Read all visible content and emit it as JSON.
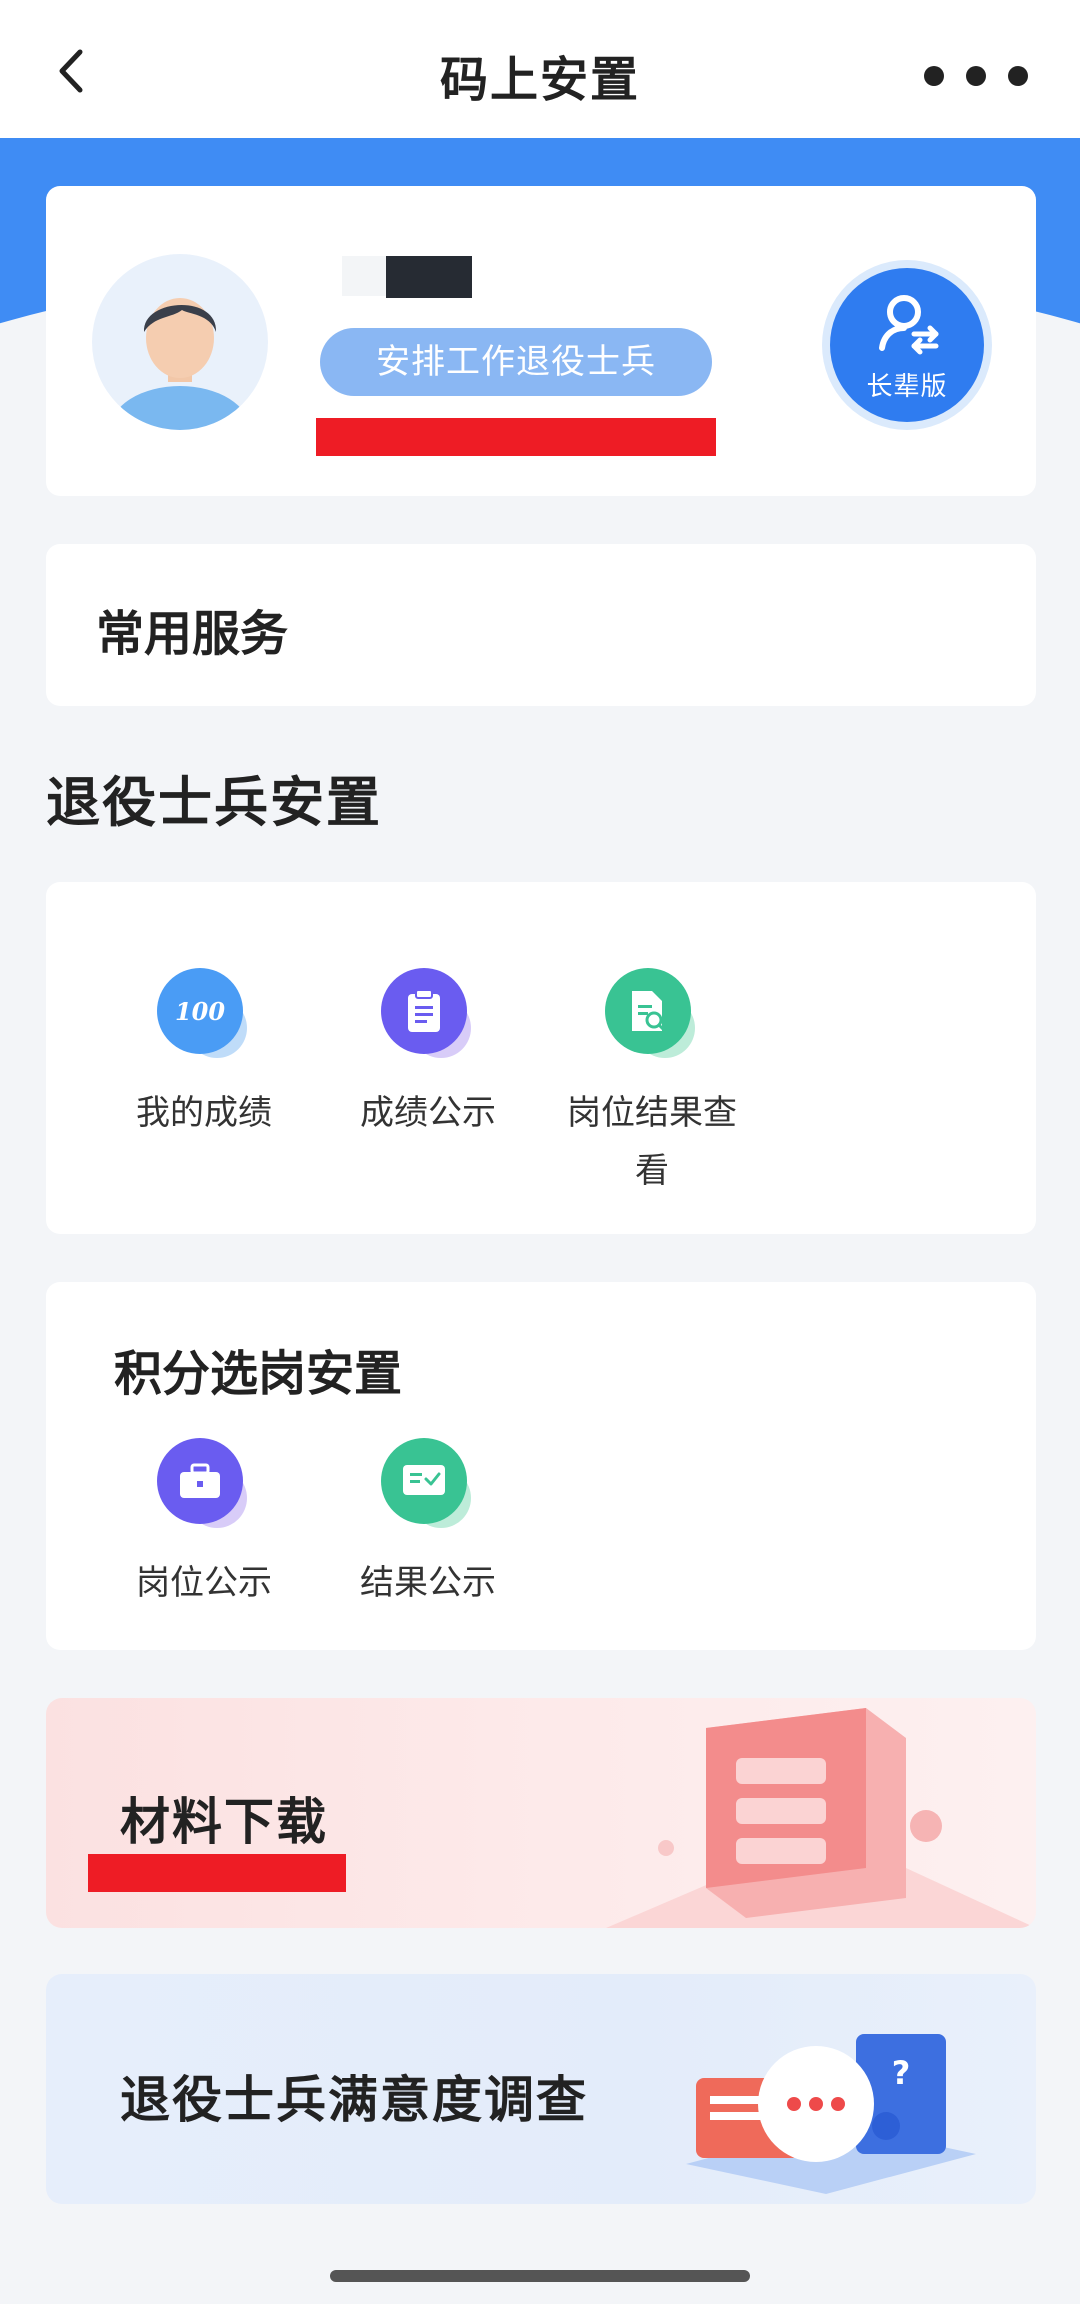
{
  "nav": {
    "title": "码上安置"
  },
  "profile": {
    "tag": "安排工作退役士兵",
    "elder_mode_label": "长辈版"
  },
  "common_services": {
    "label": "常用服务"
  },
  "section": {
    "title": "退役士兵安置"
  },
  "group1": {
    "items": [
      {
        "label": "我的成绩",
        "icon": "score-100-icon",
        "color": "#4a9cf5"
      },
      {
        "label": "成绩公示",
        "icon": "clipboard-icon",
        "color": "#6a5cf0"
      },
      {
        "label": "岗位结果查看",
        "icon": "document-search-icon",
        "color": "#39c393"
      }
    ]
  },
  "group2": {
    "title": "积分选岗安置",
    "items": [
      {
        "label": "岗位公示",
        "icon": "briefcase-icon",
        "color": "#6a5cf0"
      },
      {
        "label": "结果公示",
        "icon": "result-board-icon",
        "color": "#39c393"
      }
    ]
  },
  "material": {
    "label": "材料下载"
  },
  "survey": {
    "label": "退役士兵满意度调查"
  }
}
